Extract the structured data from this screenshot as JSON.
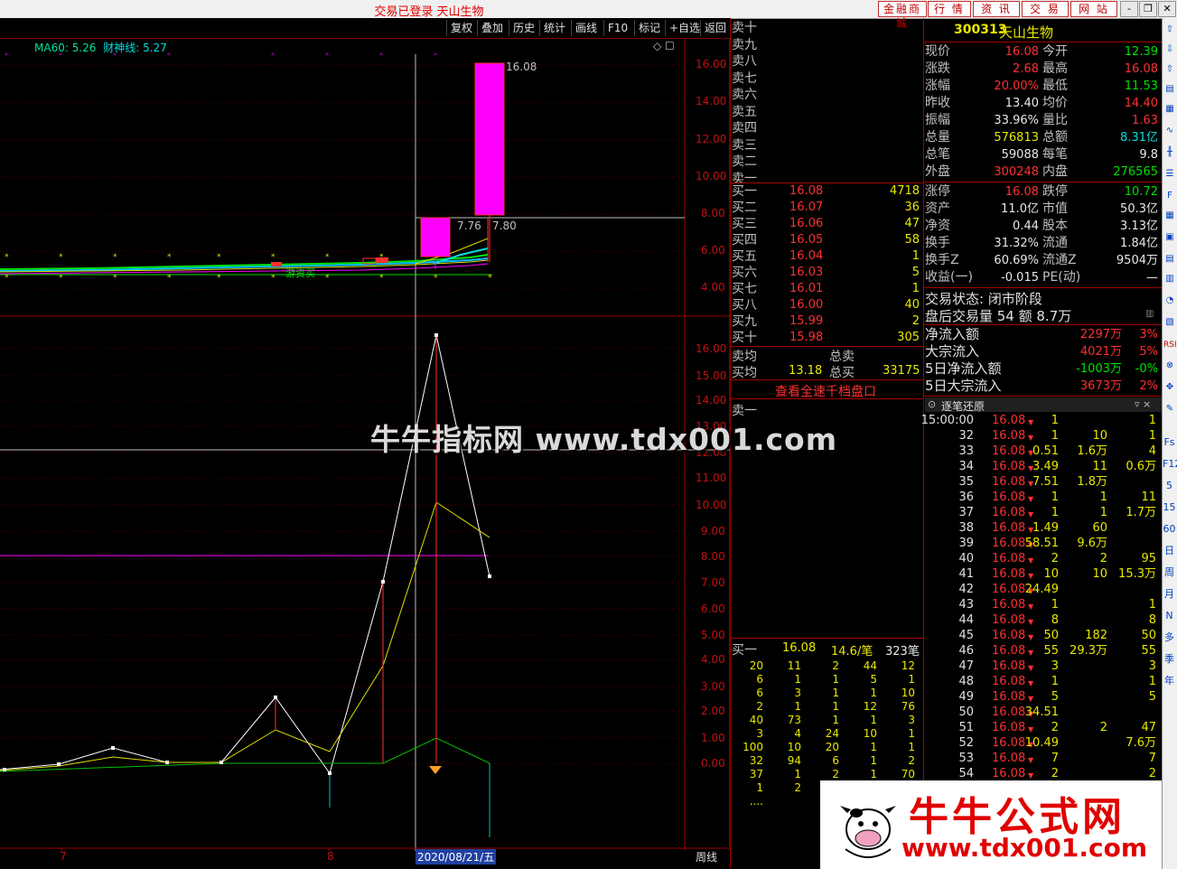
{
  "window": {
    "title": "交易已登录  天山生物",
    "top_buttons": [
      "金融商城",
      "行 情",
      "资 讯",
      "交 易",
      "网 站"
    ],
    "controls": [
      "-",
      "❐",
      "✕"
    ]
  },
  "toolbar": [
    "复权",
    "叠加",
    "历史",
    "统计",
    "画线",
    "F10",
    "标记",
    "+自选",
    "返回"
  ],
  "kline": {
    "legend_ma60": "MA60: 5.26",
    "legend_cs": "财神线: 5.27",
    "y_labels": [
      "16.00",
      "14.00",
      "12.00",
      "10.00",
      "8.00",
      "6.00",
      "4.00"
    ],
    "annot_high": "16.08",
    "annot_mid": "7.76",
    "annot_mid2": "7.80",
    "marker_text": "游资买"
  },
  "indicator": {
    "y_labels": [
      "16.00",
      "15.00",
      "14.00",
      "13.00",
      "12.00",
      "11.00",
      "10.00",
      "9.00",
      "8.00",
      "7.00",
      "6.00",
      "5.00",
      "4.00",
      "3.00",
      "2.00",
      "1.00",
      "0.00"
    ]
  },
  "xaxis": {
    "labels": [
      "7",
      "8"
    ],
    "date_label": "2020/08/21/五",
    "period": "周线"
  },
  "orderbook": {
    "sell_levels": [
      "卖十",
      "卖九",
      "卖八",
      "卖七",
      "卖六",
      "卖五",
      "卖四",
      "卖三",
      "卖二",
      "卖一"
    ],
    "buy_levels": [
      {
        "label": "买一",
        "price": "16.08",
        "vol": "4718"
      },
      {
        "label": "买二",
        "price": "16.07",
        "vol": "36"
      },
      {
        "label": "买三",
        "price": "16.06",
        "vol": "47"
      },
      {
        "label": "买四",
        "price": "16.05",
        "vol": "58"
      },
      {
        "label": "买五",
        "price": "16.04",
        "vol": "1"
      },
      {
        "label": "买六",
        "price": "16.03",
        "vol": "5"
      },
      {
        "label": "买七",
        "price": "16.01",
        "vol": "1"
      },
      {
        "label": "买八",
        "price": "16.00",
        "vol": "40"
      },
      {
        "label": "买九",
        "price": "15.99",
        "vol": "2"
      },
      {
        "label": "买十",
        "price": "15.98",
        "vol": "305"
      }
    ],
    "avg_sell_label": "卖均",
    "total_sell_label": "总卖",
    "avg_buy_label": "买均",
    "avg_buy_value": "13.18",
    "total_buy_label": "总买",
    "total_buy_value": "33175",
    "link": "查看全速千档盘口",
    "queue_sell_label": "卖一",
    "queue_buy_label": "买一",
    "queue_buy_price": "16.08",
    "queue_buy_avg": "14.6/笔",
    "queue_buy_count": "323笔",
    "queue_rows": [
      [
        "20",
        "11",
        "2",
        "44",
        "12"
      ],
      [
        "6",
        "1",
        "1",
        "5",
        "1"
      ],
      [
        "6",
        "3",
        "1",
        "1",
        "10"
      ],
      [
        "2",
        "1",
        "1",
        "12",
        "76"
      ],
      [
        "40",
        "73",
        "1",
        "1",
        "3"
      ],
      [
        "3",
        "4",
        "24",
        "10",
        "1"
      ],
      [
        "100",
        "10",
        "20",
        "1",
        "1"
      ],
      [
        "32",
        "94",
        "6",
        "1",
        "2"
      ],
      [
        "37",
        "1",
        "2",
        "1",
        "70"
      ],
      [
        "1",
        "2",
        "",
        "",
        ""
      ],
      [
        "....",
        "",
        "",
        "",
        ""
      ]
    ]
  },
  "quote": {
    "code": "300313",
    "name": "天山生物",
    "rows": [
      {
        "l1": "现价",
        "v1": "16.08",
        "c1": "red",
        "l2": "今开",
        "v2": "12.39",
        "c2": "green"
      },
      {
        "l1": "涨跌",
        "v1": "2.68",
        "c1": "red",
        "l2": "最高",
        "v2": "16.08",
        "c2": "red"
      },
      {
        "l1": "涨幅",
        "v1": "20.00%",
        "c1": "red",
        "l2": "最低",
        "v2": "11.53",
        "c2": "green"
      },
      {
        "l1": "昨收",
        "v1": "13.40",
        "c1": "white",
        "l2": "均价",
        "v2": "14.40",
        "c2": "red"
      },
      {
        "l1": "振幅",
        "v1": "33.96%",
        "c1": "white",
        "l2": "量比",
        "v2": "1.63",
        "c2": "red"
      },
      {
        "l1": "总量",
        "v1": "576813",
        "c1": "yellow",
        "l2": "总额",
        "v2": "8.31亿",
        "c2": "cyan"
      },
      {
        "l1": "总笔",
        "v1": "59088",
        "c1": "white",
        "l2": "每笔",
        "v2": "9.8",
        "c2": "white"
      },
      {
        "l1": "外盘",
        "v1": "300248",
        "c1": "red",
        "l2": "内盘",
        "v2": "276565",
        "c2": "green"
      }
    ],
    "rows2": [
      {
        "l1": "涨停",
        "v1": "16.08",
        "c1": "red",
        "l2": "跌停",
        "v2": "10.72",
        "c2": "green"
      },
      {
        "l1": "资产",
        "v1": "11.0亿",
        "c1": "white",
        "l2": "市值",
        "v2": "50.3亿",
        "c2": "white"
      },
      {
        "l1": "净资",
        "v1": "0.44",
        "c1": "white",
        "l2": "股本",
        "v2": "3.13亿",
        "c2": "white"
      },
      {
        "l1": "换手",
        "v1": "31.32%",
        "c1": "white",
        "l2": "流通",
        "v2": "1.84亿",
        "c2": "white"
      },
      {
        "l1": "换手Z",
        "v1": "60.69%",
        "c1": "white",
        "l2": "流通Z",
        "v2": "9504万",
        "c2": "white"
      },
      {
        "l1": "收益(一)",
        "v1": "-0.015",
        "c1": "white",
        "l2": "PE(动)",
        "v2": "—",
        "c2": "white"
      }
    ],
    "trade_status": "交易状态: 闭市阶段",
    "after_hours": "盘后交易量 54 额 8.7万",
    "flows": [
      {
        "label": "净流入额",
        "v1": "2297万",
        "c1": "red",
        "v2": "3%",
        "c2": "red"
      },
      {
        "label": "大宗流入",
        "v1": "4021万",
        "c1": "red",
        "v2": "5%",
        "c2": "red"
      },
      {
        "label": "5日净流入额",
        "v1": "-1003万",
        "c1": "green",
        "v2": "-0%",
        "c2": "green"
      },
      {
        "label": "5日大宗流入",
        "v1": "3673万",
        "c1": "red",
        "v2": "2%",
        "c2": "red"
      }
    ]
  },
  "ticks": {
    "header": "逐笔还原",
    "rows": [
      {
        "t": "15:00:00",
        "p": "16.08",
        "v": "1",
        "a": "",
        "b": "1"
      },
      {
        "t": "32",
        "p": "16.08",
        "v": "1",
        "a": "10",
        "b": "1"
      },
      {
        "t": "33",
        "p": "16.08",
        "v": "0.51",
        "a": "1.6万",
        "b": "4"
      },
      {
        "t": "34",
        "p": "16.08",
        "v": "3.49",
        "a": "11",
        "b": "0.6万"
      },
      {
        "t": "35",
        "p": "16.08",
        "v": "7.51",
        "a": "1.8万",
        "b": ""
      },
      {
        "t": "36",
        "p": "16.08",
        "v": "1",
        "a": "1",
        "b": "11"
      },
      {
        "t": "37",
        "p": "16.08",
        "v": "1",
        "a": "1",
        "b": "1.7万"
      },
      {
        "t": "38",
        "p": "16.08",
        "v": "1.49",
        "a": "60",
        "b": ""
      },
      {
        "t": "39",
        "p": "16.08",
        "v": "58.51",
        "a": "9.6万",
        "b": ""
      },
      {
        "t": "40",
        "p": "16.08",
        "v": "2",
        "a": "2",
        "b": "95"
      },
      {
        "t": "41",
        "p": "16.08",
        "v": "10",
        "a": "10",
        "b": "15.3万"
      },
      {
        "t": "42",
        "p": "16.08",
        "v": "24.49",
        "a": "",
        "b": ""
      },
      {
        "t": "43",
        "p": "16.08",
        "v": "1",
        "a": "",
        "b": "1"
      },
      {
        "t": "44",
        "p": "16.08",
        "v": "8",
        "a": "",
        "b": "8"
      },
      {
        "t": "45",
        "p": "16.08",
        "v": "50",
        "a": "182",
        "b": "50"
      },
      {
        "t": "46",
        "p": "16.08",
        "v": "55",
        "a": "29.3万",
        "b": "55"
      },
      {
        "t": "47",
        "p": "16.08",
        "v": "3",
        "a": "",
        "b": "3"
      },
      {
        "t": "48",
        "p": "16.08",
        "v": "1",
        "a": "",
        "b": "1"
      },
      {
        "t": "49",
        "p": "16.08",
        "v": "5",
        "a": "",
        "b": "5"
      },
      {
        "t": "50",
        "p": "16.08",
        "v": "34.51",
        "a": "",
        "b": ""
      },
      {
        "t": "51",
        "p": "16.08",
        "v": "2",
        "a": "2",
        "b": "47"
      },
      {
        "t": "52",
        "p": "16.08",
        "v": "10.49",
        "a": "",
        "b": "7.6万"
      },
      {
        "t": "53",
        "p": "16.08",
        "v": "7",
        "a": "",
        "b": "7"
      },
      {
        "t": "54",
        "p": "16.08",
        "v": "2",
        "a": "",
        "b": "2"
      }
    ]
  },
  "sidebar_icons": [
    "Fs",
    "F12",
    "5",
    "15",
    "60",
    "日",
    "周",
    "月",
    "N",
    "多",
    "季",
    "年"
  ],
  "watermarks": {
    "center": "牛牛指标网 www.tdx001.com",
    "corner_title": "牛牛公式网",
    "corner_url": "www.tdx001.com"
  },
  "colors": {
    "accent_red": "#ff3030",
    "magenta": "#ff00ff",
    "frame": "#a00000"
  }
}
